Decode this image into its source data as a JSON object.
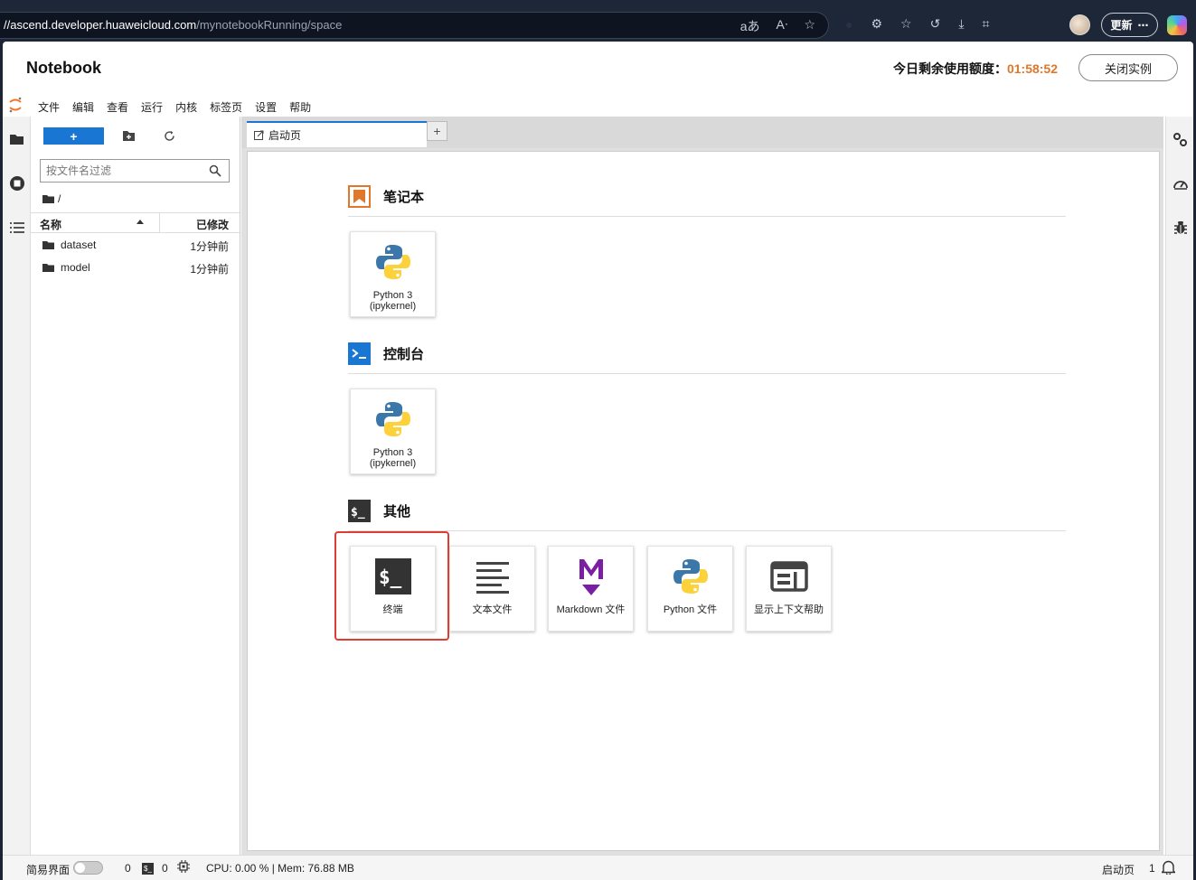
{
  "browser": {
    "url_host": "//ascend.developer.huaweicloud.com",
    "url_path": "/mynotebookRunning/space",
    "update_label": "更新",
    "more_label": "⋯"
  },
  "app": {
    "title": "Notebook",
    "quota_label": "今日剩余使用额度：",
    "quota_time": "01:58:52",
    "close_label": "关闭实例"
  },
  "menu": {
    "items": [
      "文件",
      "编辑",
      "查看",
      "运行",
      "内核",
      "标签页",
      "设置",
      "帮助"
    ]
  },
  "filebrowser": {
    "new_label": "+",
    "filter_placeholder": "按文件名过滤",
    "breadcrumb": "/",
    "col_name": "名称",
    "col_modified": "已修改",
    "files": [
      {
        "name": "dataset",
        "modified": "1分钟前"
      },
      {
        "name": "model",
        "modified": "1分钟前"
      }
    ]
  },
  "tabs": {
    "active_label": "启动页",
    "add_label": "+"
  },
  "launcher": {
    "sections": [
      {
        "title": "笔记本",
        "cards": [
          {
            "label": "Python 3 (ipykernel)"
          }
        ]
      },
      {
        "title": "控制台",
        "cards": [
          {
            "label": "Python 3 (ipykernel)"
          }
        ]
      },
      {
        "title": "其他",
        "cards": [
          {
            "label": "终端"
          },
          {
            "label": "文本文件"
          },
          {
            "label": "Markdown 文件"
          },
          {
            "label": "Python 文件"
          },
          {
            "label": "显示上下文帮助"
          }
        ]
      }
    ]
  },
  "statusbar": {
    "simple_mode": "简易界面",
    "kernels_count": "0",
    "terminals_count": "0",
    "resources": "CPU: 0.00 % | Mem: 76.88 MB",
    "current_tab": "启动页",
    "notifications": "1"
  },
  "colors": {
    "accent": "#1976d2",
    "quota_time": "#e0772b",
    "highlight": "#e03c31"
  }
}
